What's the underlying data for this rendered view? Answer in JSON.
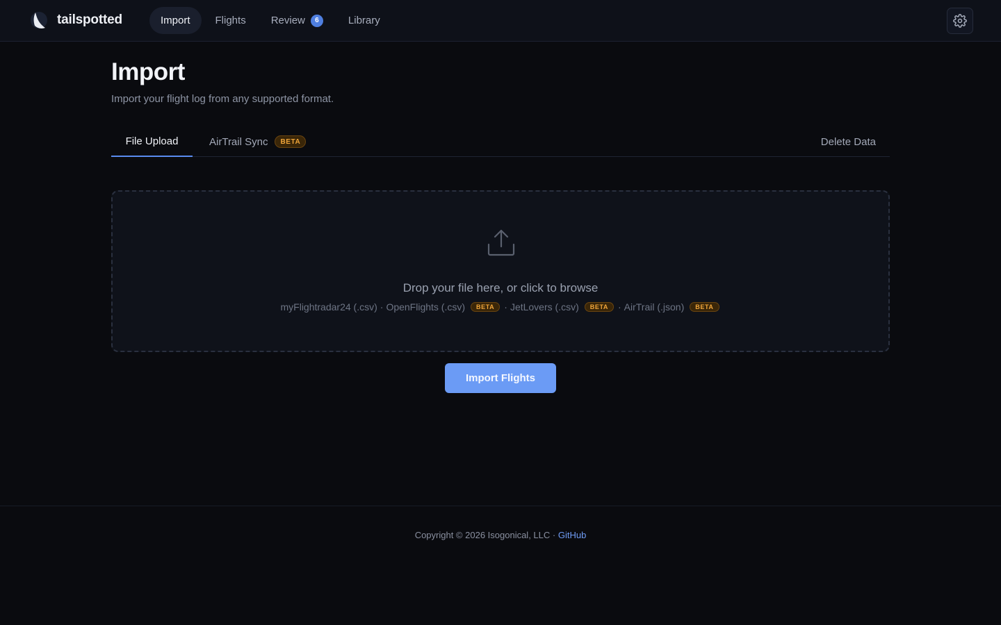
{
  "app": {
    "name": "tailspotted",
    "accent_color": "#6b9bf5",
    "beta_color": "#f0a53a"
  },
  "nav": {
    "items": [
      {
        "label": "Import",
        "active": true
      },
      {
        "label": "Flights",
        "active": false
      },
      {
        "label": "Review",
        "active": false,
        "badge": "6"
      },
      {
        "label": "Library",
        "active": false
      }
    ],
    "settings_icon": "gear-icon"
  },
  "page": {
    "title": "Import",
    "subtitle": "Import your flight log from any supported format."
  },
  "tabs": {
    "file_upload": "File Upload",
    "airtrail_sync": "AirTrail Sync",
    "airtrail_badge": "BETA",
    "delete_data": "Delete Data"
  },
  "dropzone": {
    "icon": "upload-icon",
    "title": "Drop your file here, or click to browse",
    "formats": [
      {
        "label": "myFlightradar24 (.csv)",
        "beta": ""
      },
      {
        "label": "OpenFlights (.csv)",
        "beta": "BETA"
      },
      {
        "label": "JetLovers (.csv)",
        "beta": "BETA"
      },
      {
        "label": "AirTrail (.json)",
        "beta": "BETA"
      }
    ],
    "separator": "·"
  },
  "import_button": "Import Flights",
  "footer": {
    "copyright": "Copyright © 2026 Isogonical, LLC ·",
    "link": "GitHub"
  }
}
